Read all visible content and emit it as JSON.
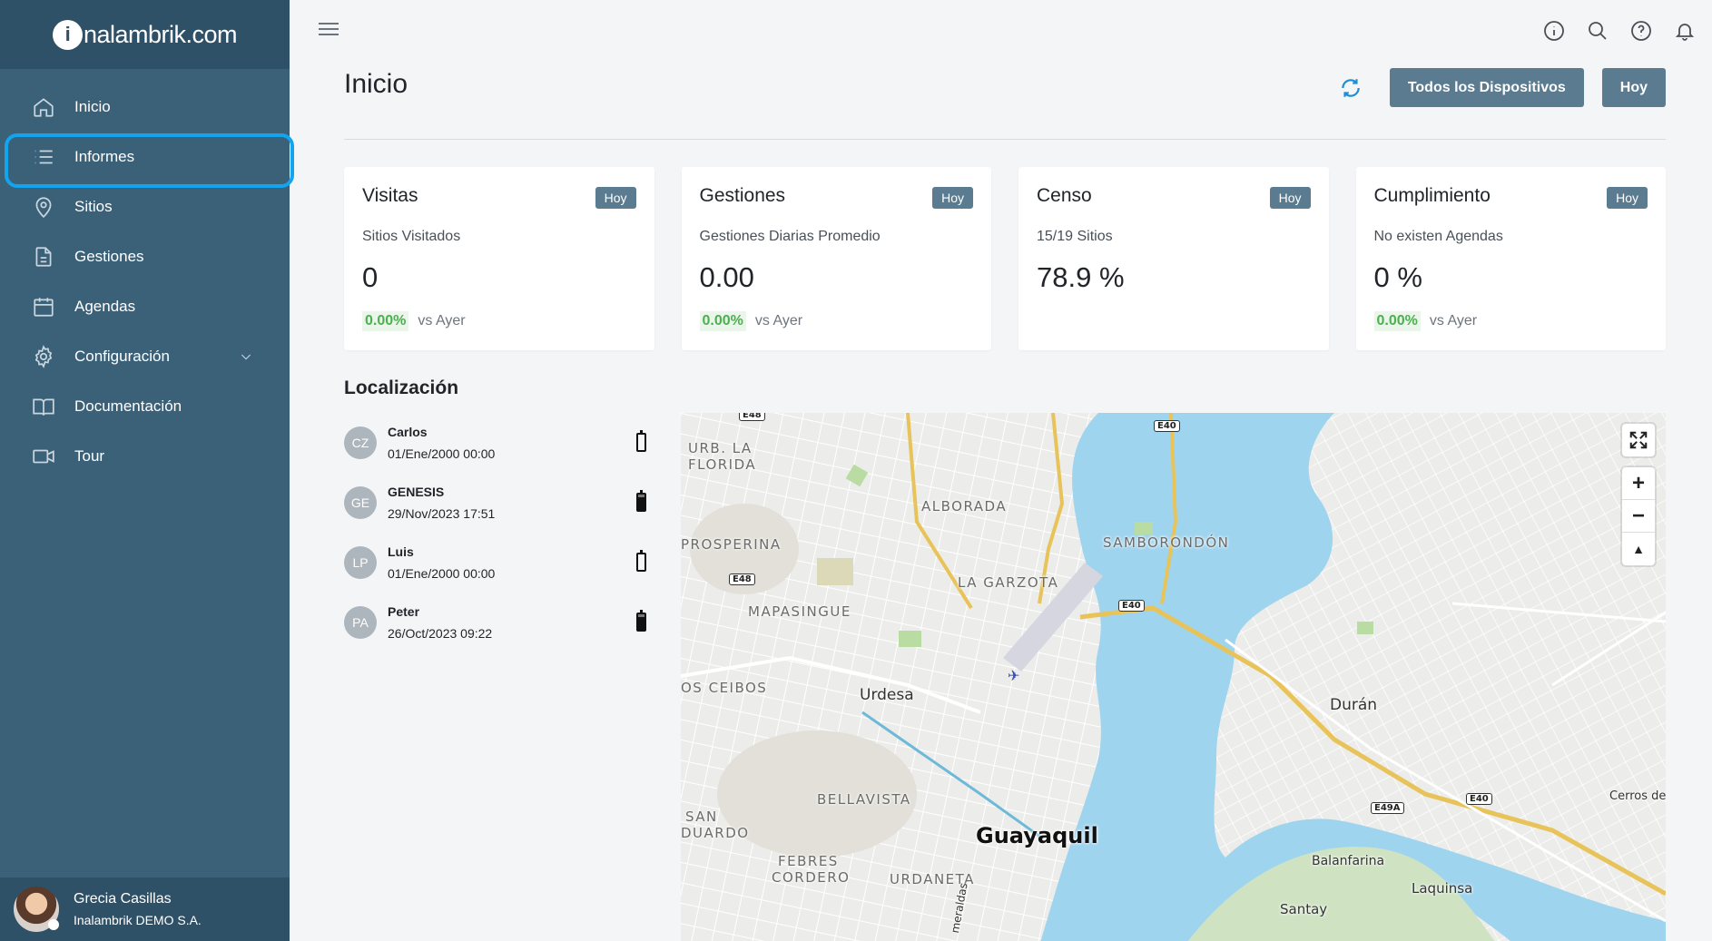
{
  "brand": {
    "logo_prefix": "i",
    "logo_text": "nalambrik.com"
  },
  "sidebar": {
    "items": [
      {
        "label": "Inicio",
        "icon": "home-icon"
      },
      {
        "label": "Informes",
        "icon": "list-icon",
        "active": true
      },
      {
        "label": "Sitios",
        "icon": "map-pin-icon"
      },
      {
        "label": "Gestiones",
        "icon": "document-icon"
      },
      {
        "label": "Agendas",
        "icon": "calendar-icon"
      },
      {
        "label": "Configuración",
        "icon": "gear-icon"
      },
      {
        "label": "Documentación",
        "icon": "book-icon"
      },
      {
        "label": "Tour",
        "icon": "video-icon"
      }
    ],
    "user": {
      "name": "Grecia Casillas",
      "org": "Inalambrik DEMO S.A."
    }
  },
  "header": {
    "title": "Inicio",
    "devices_button": "Todos los Dispositivos",
    "date_button": "Hoy"
  },
  "cards": [
    {
      "title": "Visitas",
      "badge": "Hoy",
      "subtitle": "Sitios Visitados",
      "value": "0",
      "pct": "0.00%",
      "compare": "vs Ayer"
    },
    {
      "title": "Gestiones",
      "badge": "Hoy",
      "subtitle": "Gestiones Diarias Promedio",
      "value": "0.00",
      "pct": "0.00%",
      "compare": "vs Ayer"
    },
    {
      "title": "Censo",
      "badge": "Hoy",
      "subtitle": "15/19 Sitios",
      "value": "78.9 %"
    },
    {
      "title": "Cumplimiento",
      "badge": "Hoy",
      "subtitle": "No existen Agendas",
      "value": "0 %",
      "pct": "0.00%",
      "compare": "vs Ayer"
    }
  ],
  "location": {
    "title": "Localización",
    "devices": [
      {
        "initials": "CZ",
        "name": "Carlos",
        "date": "01/Ene/2000 00:00",
        "battery": "empty"
      },
      {
        "initials": "GE",
        "name": "GENESIS",
        "date": "29/Nov/2023 17:51",
        "battery": "full"
      },
      {
        "initials": "LP",
        "name": "Luis",
        "date": "01/Ene/2000 00:00",
        "battery": "empty"
      },
      {
        "initials": "PA",
        "name": "Peter",
        "date": "26/Oct/2023 09:22",
        "battery": "full"
      }
    ]
  },
  "map": {
    "labels": {
      "urb_la": "URB. LA",
      "florida": "FLORIDA",
      "alborada": "ALBORADA",
      "prosperina": "PROSPERINA",
      "samborondon": "SAMBORONDÓN",
      "la_garzota": "LA GARZOTA",
      "mapasingue": "MAPASINGUE",
      "ceibos": "OS CEIBOS",
      "urdesa": "Urdesa",
      "duran": "Durán",
      "bellavista": "BELLAVISTA",
      "guayaquil": "Guayaquil",
      "san": "SAN",
      "eduardo": "DUARDO",
      "febres": "FEBRES",
      "cordero": "CORDERO",
      "urdaneta": "URDANETA",
      "balanfarina": "Balanfarina",
      "laquinsa": "Laquinsa",
      "santay": "Santay",
      "cerros": "Cerros de",
      "esmeraldas": "meraldas"
    },
    "shields": [
      "E48",
      "E40",
      "E48",
      "E40",
      "E49A",
      "E40"
    ],
    "controls": {
      "zoom_in": "+",
      "zoom_out": "−",
      "compass": "▲"
    }
  }
}
